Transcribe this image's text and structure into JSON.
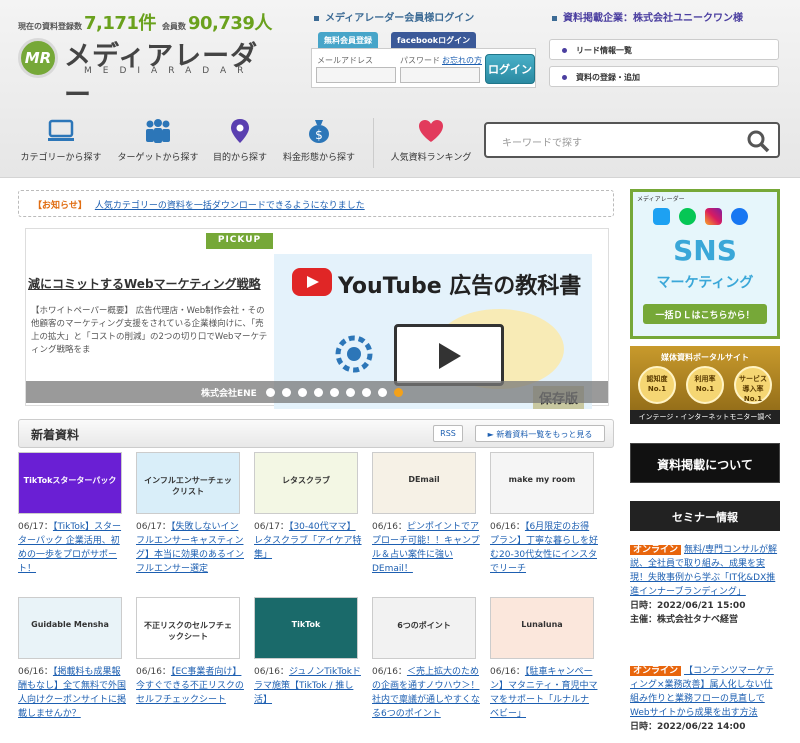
{
  "header": {
    "stats": {
      "label1": "現在の資料登録数",
      "value1": "7,171件",
      "label2": "会員数",
      "value2": "90,739人"
    },
    "logo": {
      "mark": "MR",
      "jp": "メディアレーダー",
      "en": "MEDIARADAR"
    },
    "member_login_title": "メディアレーダー会員様ログイン",
    "tab_free": "無料会員登録",
    "tab_fb": "facebookログイン",
    "mail_label": "メールアドレス",
    "pass_label": "パスワード",
    "forgot_label": "お忘れの方",
    "login_button": "ログイン",
    "corp_title": "資料掲載企業：株式会社ユニークワン様",
    "corp_links": [
      "リード情報一覧",
      "資料の登録・追加"
    ]
  },
  "nav": {
    "items": [
      "カテゴリーから探す",
      "ターゲットから探す",
      "目的から探す",
      "料金形態から探す",
      "人気資料ランキング"
    ],
    "search_placeholder": "キーワードで探す"
  },
  "notice": {
    "tag": "【お知らせ】",
    "text": "人気カテゴリーの資料を一括ダウンロードできるようになりました"
  },
  "pickup": {
    "badge": "PICKUP",
    "title": "減にコミットするWebマーケティング戦略",
    "desc": "【ホワイトペーパー概要】 広告代理店・Web制作会社・その他顧客のマーケティング支援をされている企業様向けに、「売上の拡大」と「コストの削減」の2つの切り口でWebマーケティング戦略をま",
    "image_title": "広告の教科書",
    "image_brand": "YouTube",
    "image_badge": "保存版",
    "company": "株式会社ENE"
  },
  "new_docs": {
    "title": "新着資料",
    "rss": "RSS",
    "more": "► 新着資料一覧をもっと見る",
    "cards": [
      {
        "date": "06/17：",
        "title": "【TikTok】スターターパック 企業活用、初めの一歩をプロがサポート！",
        "thumb_text": "TikTokスターターパック",
        "thumb_bg": "#6a1fd4"
      },
      {
        "date": "06/17：",
        "title": "【失敗しないインフルエンサーキャスティング】本当に効果のあるインフルエンサー選定",
        "thumb_text": "インフルエンサーチェックリスト",
        "thumb_bg": "#d9eef9"
      },
      {
        "date": "06/17：",
        "title": "【30-40代ママ】レタスクラブ「アイケア特集」",
        "thumb_text": "レタスクラブ",
        "thumb_bg": "#f3f7e4"
      },
      {
        "date": "06/16：",
        "title": "ピンポイントでアプローチ可能！！キャンプル＆占い案件に強いDEmail！",
        "thumb_text": "DEmail",
        "thumb_bg": "#f6f1e6"
      },
      {
        "date": "06/16：",
        "title": "【6月限定のお得プラン】丁寧な暮らしを好む20-30代女性にインスタでリーチ",
        "thumb_text": "make my room",
        "thumb_bg": "#f5f5f5"
      },
      {
        "date": "06/16：",
        "title": "【掲載料も成果報酬もなし】全て無料で外国人向けクーポンサイトに掲載しませんか？",
        "thumb_text": "Guidable Mensha",
        "thumb_bg": "#e9f3f8"
      },
      {
        "date": "06/16：",
        "title": "【EC事業者向け】今すぐできる不正リスクのセルフチェックシート",
        "thumb_text": "不正リスクのセルフチェックシート",
        "thumb_bg": "#ffffff"
      },
      {
        "date": "06/16：",
        "title": "ジュノンTikTokドラマ施策【TikTok / 推し活】",
        "thumb_text": "TikTok",
        "thumb_bg": "#1a6a6a"
      },
      {
        "date": "06/16：",
        "title": "＜売上拡大のための企画を通すノウハウ＞！社内で稟議が通しやすくなる6つのポイント",
        "thumb_text": "6つのポイント",
        "thumb_bg": "#f2f2f2"
      },
      {
        "date": "06/16：",
        "title": "【駐車キャンペーン】マタニティ・育児中ママをサポート「ルナルナ ベビー」",
        "thumb_text": "Lunaluna",
        "thumb_bg": "#fbe7dc"
      }
    ]
  },
  "sidebar": {
    "sns": {
      "logo": "メディアレーダー",
      "title": "SNS",
      "subtitle": "マーケティング",
      "cta": "一括ＤＬはこちらから！"
    },
    "award": {
      "top": "媒体資料ポータルサイト",
      "medals": [
        "認知度 No.1",
        "利用率 No.1",
        "サービス導入率 No.1"
      ],
      "bottom": "インテージ・インターネットモニター調べ"
    },
    "listing": "資料掲載について",
    "seminar_title": "セミナー情報",
    "seminars": [
      {
        "badge": "オンライン",
        "title": "無料/専門コンサルが解説、全社員で取り組み、成果を実現！失敗事例から学ぶ「IT化&DX推進インナーブランディング」",
        "date": "日時：2022/06/21 15:00",
        "host": "主催：株式会社タナベ経営"
      },
      {
        "badge": "オンライン",
        "title": "【コンテンツマーケティング×業務改善】属人化しない仕組み作りと業務フローの見直しでWebサイトから成果を出す方法",
        "date": "日時：2022/06/22 14:00",
        "host": ""
      }
    ]
  },
  "colors": {
    "brand_green": "#76a838",
    "link_blue": "#1d5fb1",
    "accent_orange": "#e8650c"
  }
}
